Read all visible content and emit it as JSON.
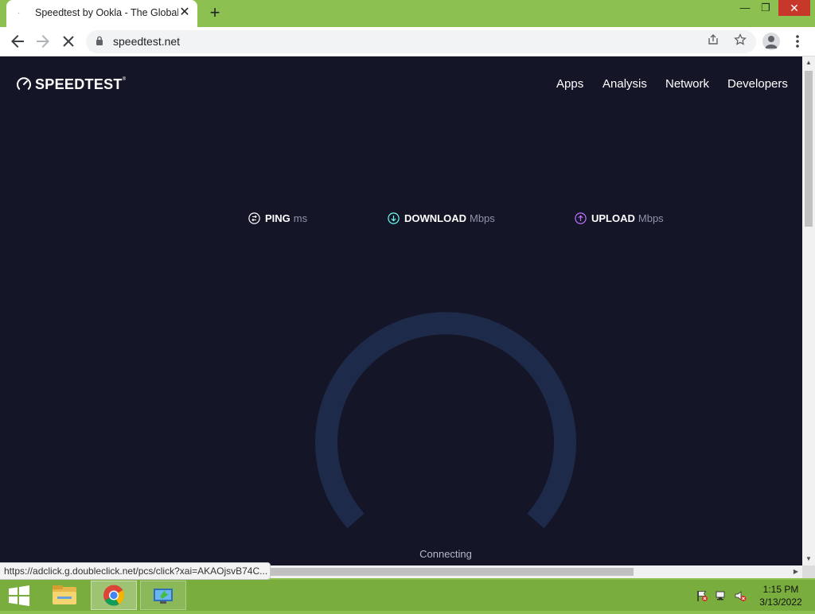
{
  "browser": {
    "tab_title": "Speedtest by Ookla - The Global Broadband Speed Test",
    "tab_favicon": "·",
    "tab_close": "✕",
    "new_tab": "+",
    "window_controls": {
      "minimize": "—",
      "restore": "❐",
      "close": "✕"
    },
    "url": "speedtest.net",
    "icons": [
      "back-arrow-icon",
      "forward-arrow-icon",
      "stop-loading-icon",
      "lock-icon",
      "share-icon",
      "star-icon",
      "profile-icon",
      "kebab-menu-icon"
    ]
  },
  "page": {
    "logo_text": "SPEEDTEST",
    "logo_tm": "®",
    "nav": [
      "Apps",
      "Analysis",
      "Network",
      "Developers"
    ],
    "metrics": {
      "ping": {
        "label": "PING",
        "unit": "ms",
        "color": "#ffffff"
      },
      "download": {
        "label": "DOWNLOAD",
        "unit": "Mbps",
        "color": "#6afff3"
      },
      "upload": {
        "label": "UPLOAD",
        "unit": "Mbps",
        "color": "#bf71ff"
      }
    },
    "status": "Connecting",
    "colors": {
      "background": "#141526",
      "gauge_track": "#1e2a4a"
    }
  },
  "statusbar": {
    "hover_url": "https://adclick.g.doubleclick.net/pcs/click?xai=AKAOjsvB74C..."
  },
  "taskbar": {
    "apps": [
      "start-windows-icon",
      "file-explorer-icon",
      "chrome-icon",
      "remote-desktop-icon"
    ],
    "tray": [
      "action-center-flag-icon",
      "network-icon",
      "volume-muted-icon"
    ],
    "time": "1:15 PM",
    "date": "3/13/2022"
  }
}
